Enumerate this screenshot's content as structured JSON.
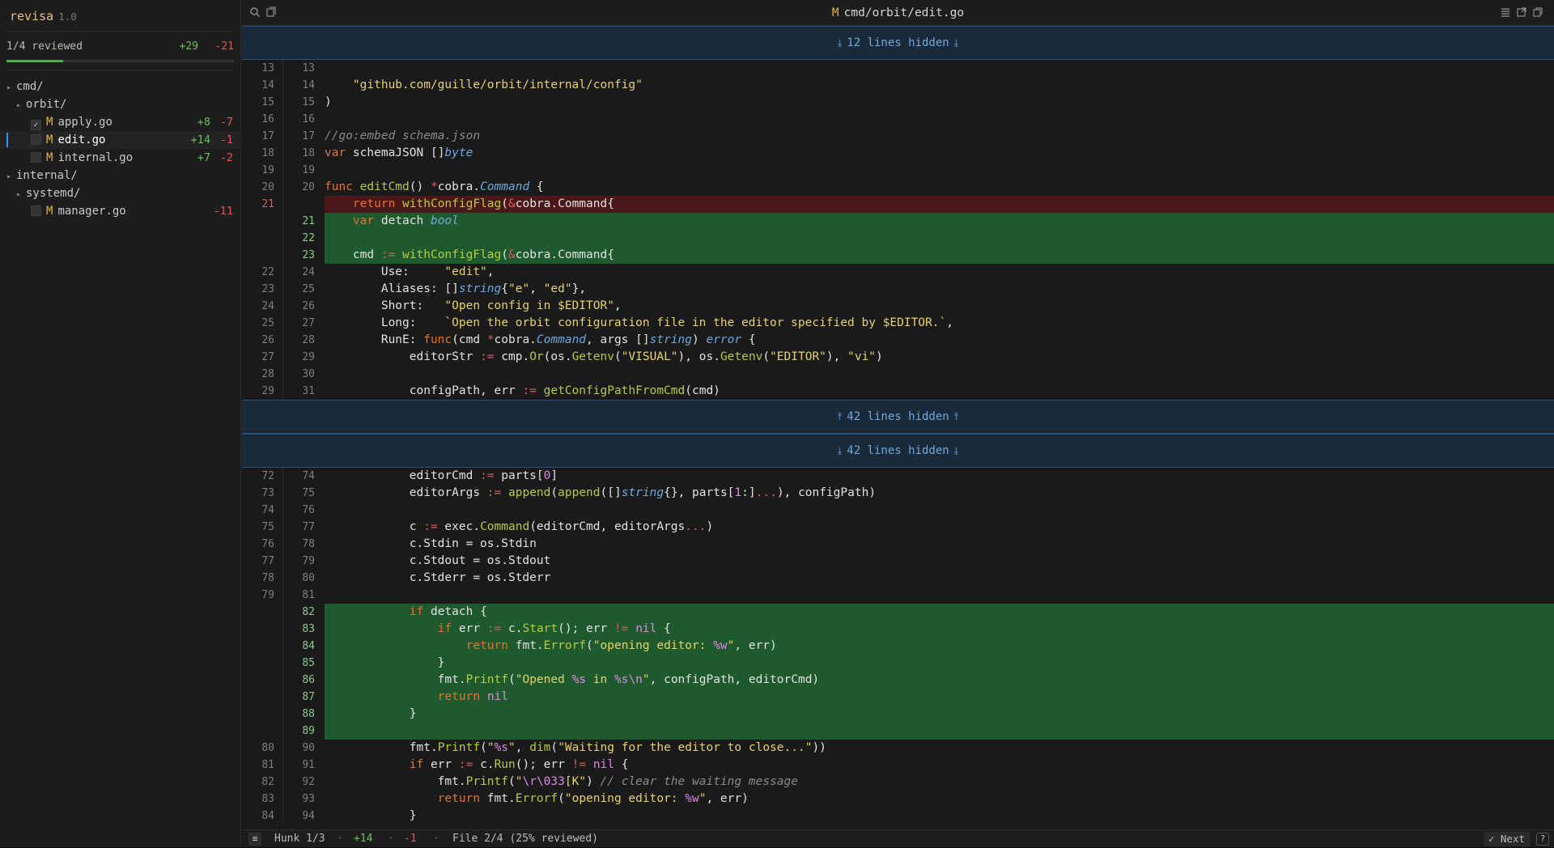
{
  "app": {
    "name": "revisa",
    "version": "1.0"
  },
  "summary": {
    "reviewed": "1/4 reviewed",
    "additions": "+29",
    "deletions": "-21",
    "progress_fraction": 0.25
  },
  "tree": [
    {
      "kind": "dir",
      "depth": 0,
      "label": "cmd/"
    },
    {
      "kind": "dir",
      "depth": 1,
      "label": "orbit/"
    },
    {
      "kind": "file",
      "depth": 2,
      "status": "M",
      "label": "apply.go",
      "checked": true,
      "add": "+8",
      "del": "-7"
    },
    {
      "kind": "file",
      "depth": 2,
      "status": "M",
      "label": "edit.go",
      "checked": false,
      "selected": true,
      "add": "+14",
      "del": "-1"
    },
    {
      "kind": "file",
      "depth": 2,
      "status": "M",
      "label": "internal.go",
      "checked": false,
      "add": "+7",
      "del": "-2"
    },
    {
      "kind": "dir",
      "depth": 0,
      "label": "internal/"
    },
    {
      "kind": "dir",
      "depth": 1,
      "label": "systemd/"
    },
    {
      "kind": "file",
      "depth": 2,
      "status": "M",
      "label": "manager.go",
      "checked": false,
      "add": "",
      "del": "-11"
    }
  ],
  "header": {
    "status": "M",
    "path": "cmd/orbit/edit.go"
  },
  "diff": [
    {
      "type": "hidden",
      "label": "12 lines hidden",
      "dir": "down"
    },
    {
      "type": "ctx",
      "old": "13",
      "new": "13",
      "code": ""
    },
    {
      "type": "ctx",
      "old": "14",
      "new": "14",
      "code": "    \"github.com/guille/orbit/internal/config\""
    },
    {
      "type": "ctx",
      "old": "15",
      "new": "15",
      "code": ")"
    },
    {
      "type": "ctx",
      "old": "16",
      "new": "16",
      "code": ""
    },
    {
      "type": "ctx",
      "old": "17",
      "new": "17",
      "code": "//go:embed schema.json"
    },
    {
      "type": "ctx",
      "old": "18",
      "new": "18",
      "code": "var schemaJSON []byte"
    },
    {
      "type": "ctx",
      "old": "19",
      "new": "19",
      "code": ""
    },
    {
      "type": "ctx",
      "old": "20",
      "new": "20",
      "code": "func editCmd() *cobra.Command {"
    },
    {
      "type": "del",
      "old": "21",
      "new": "",
      "code": "    return withConfigFlag(&cobra.Command{"
    },
    {
      "type": "add",
      "old": "",
      "new": "21",
      "code": "    var detach bool"
    },
    {
      "type": "add",
      "old": "",
      "new": "22",
      "code": ""
    },
    {
      "type": "add",
      "old": "",
      "new": "23",
      "code": "    cmd := withConfigFlag(&cobra.Command{"
    },
    {
      "type": "ctx",
      "old": "22",
      "new": "24",
      "code": "        Use:     \"edit\","
    },
    {
      "type": "ctx",
      "old": "23",
      "new": "25",
      "code": "        Aliases: []string{\"e\", \"ed\"},"
    },
    {
      "type": "ctx",
      "old": "24",
      "new": "26",
      "code": "        Short:   \"Open config in $EDITOR\","
    },
    {
      "type": "ctx",
      "old": "25",
      "new": "27",
      "code": "        Long:    `Open the orbit configuration file in the editor specified by $EDITOR.`,"
    },
    {
      "type": "ctx",
      "old": "26",
      "new": "28",
      "code": "        RunE: func(cmd *cobra.Command, args []string) error {"
    },
    {
      "type": "ctx",
      "old": "27",
      "new": "29",
      "code": "            editorStr := cmp.Or(os.Getenv(\"VISUAL\"), os.Getenv(\"EDITOR\"), \"vi\")"
    },
    {
      "type": "ctx",
      "old": "28",
      "new": "30",
      "code": ""
    },
    {
      "type": "ctx",
      "old": "29",
      "new": "31",
      "code": "            configPath, err := getConfigPathFromCmd(cmd)"
    },
    {
      "type": "hidden",
      "label": "42 lines hidden",
      "dir": "up"
    },
    {
      "type": "hidden",
      "label": "42 lines hidden",
      "dir": "down"
    },
    {
      "type": "ctx",
      "old": "72",
      "new": "74",
      "code": "            editorCmd := parts[0]"
    },
    {
      "type": "ctx",
      "old": "73",
      "new": "75",
      "code": "            editorArgs := append(append([]string{}, parts[1:]...), configPath)"
    },
    {
      "type": "ctx",
      "old": "74",
      "new": "76",
      "code": ""
    },
    {
      "type": "ctx",
      "old": "75",
      "new": "77",
      "code": "            c := exec.Command(editorCmd, editorArgs...)"
    },
    {
      "type": "ctx",
      "old": "76",
      "new": "78",
      "code": "            c.Stdin = os.Stdin"
    },
    {
      "type": "ctx",
      "old": "77",
      "new": "79",
      "code": "            c.Stdout = os.Stdout"
    },
    {
      "type": "ctx",
      "old": "78",
      "new": "80",
      "code": "            c.Stderr = os.Stderr"
    },
    {
      "type": "ctx",
      "old": "79",
      "new": "81",
      "code": ""
    },
    {
      "type": "add",
      "old": "",
      "new": "82",
      "code": "            if detach {"
    },
    {
      "type": "add",
      "old": "",
      "new": "83",
      "code": "                if err := c.Start(); err != nil {"
    },
    {
      "type": "add",
      "old": "",
      "new": "84",
      "code": "                    return fmt.Errorf(\"opening editor: %w\", err)"
    },
    {
      "type": "add",
      "old": "",
      "new": "85",
      "code": "                }"
    },
    {
      "type": "add",
      "old": "",
      "new": "86",
      "code": "                fmt.Printf(\"Opened %s in %s\\n\", configPath, editorCmd)"
    },
    {
      "type": "add",
      "old": "",
      "new": "87",
      "code": "                return nil"
    },
    {
      "type": "add",
      "old": "",
      "new": "88",
      "code": "            }"
    },
    {
      "type": "add",
      "old": "",
      "new": "89",
      "code": ""
    },
    {
      "type": "ctx",
      "old": "80",
      "new": "90",
      "code": "            fmt.Printf(\"%s\", dim(\"Waiting for the editor to close...\"))"
    },
    {
      "type": "ctx",
      "old": "81",
      "new": "91",
      "code": "            if err := c.Run(); err != nil {"
    },
    {
      "type": "ctx",
      "old": "82",
      "new": "92",
      "code": "                fmt.Printf(\"\\r\\033[K\") // clear the waiting message"
    },
    {
      "type": "ctx",
      "old": "83",
      "new": "93",
      "code": "                return fmt.Errorf(\"opening editor: %w\", err)"
    },
    {
      "type": "ctx",
      "old": "84",
      "new": "94",
      "code": "            }"
    }
  ],
  "status": {
    "hunk": "Hunk 1/3",
    "add": "+14",
    "del": "-1",
    "file": "File 2/4 (25% reviewed)",
    "next": "Next"
  },
  "icons": {
    "search": "search-icon",
    "copy": "copy-icon",
    "list": "list-icon",
    "external": "external-link-icon",
    "windows": "windows-icon"
  }
}
